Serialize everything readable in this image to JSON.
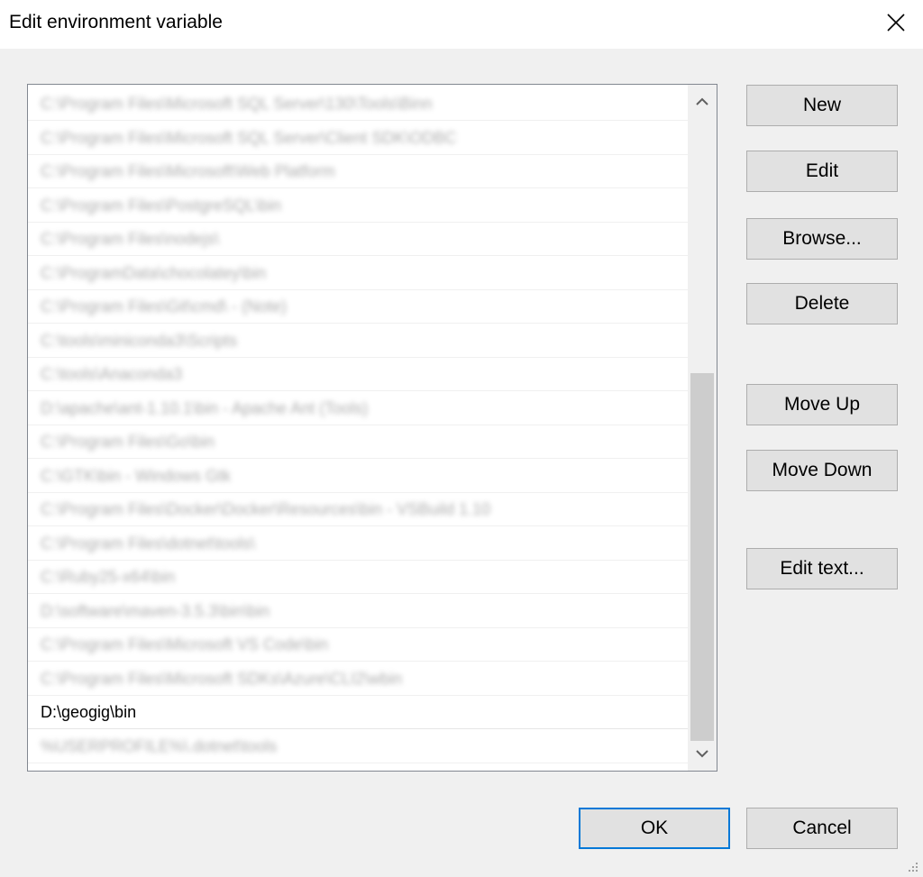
{
  "window": {
    "title": "Edit environment variable",
    "close_icon": "close-icon"
  },
  "list": {
    "items": [
      {
        "text": "C:\\Program Files\\Microsoft SQL Server\\130\\Tools\\Binn",
        "blurred": true
      },
      {
        "text": "C:\\Program Files\\Microsoft SQL Server\\Client SDK\\ODBC",
        "blurred": true
      },
      {
        "text": "C:\\Program Files\\Microsoft\\Web Platform",
        "blurred": true
      },
      {
        "text": "C:\\Program Files\\PostgreSQL\\bin",
        "blurred": true
      },
      {
        "text": "C:\\Program Files\\nodejs\\",
        "blurred": true
      },
      {
        "text": "C:\\ProgramData\\chocolatey\\bin",
        "blurred": true
      },
      {
        "text": "C:\\Program Files\\Git\\cmd\\ - (Note)",
        "blurred": true
      },
      {
        "text": "C:\\tools\\miniconda3\\Scripts",
        "blurred": true
      },
      {
        "text": "C:\\tools\\Anaconda3",
        "blurred": true
      },
      {
        "text": "D:\\apache\\ant-1.10.1\\bin - Apache Ant (Tools)",
        "blurred": true
      },
      {
        "text": "C:\\Program Files\\Go\\bin",
        "blurred": true
      },
      {
        "text": "C:\\GTK\\bin - Windows Gtk",
        "blurred": true
      },
      {
        "text": "C:\\Program Files\\Docker\\Docker\\Resources\\bin - VSBuild 1.10",
        "blurred": true
      },
      {
        "text": "C:\\Program Files\\dotnet\\tools\\",
        "blurred": true
      },
      {
        "text": "C:\\Ruby25-x64\\bin",
        "blurred": true
      },
      {
        "text": "D:\\software\\maven-3.5.3\\bin\\bin",
        "blurred": true
      },
      {
        "text": "C:\\Program Files\\Microsoft VS Code\\bin",
        "blurred": true
      },
      {
        "text": "C:\\Program Files\\Microsoft SDKs\\Azure\\CLI2\\wbin",
        "blurred": true
      },
      {
        "text": "D:\\geogig\\bin",
        "blurred": false
      },
      {
        "text": "%USERPROFILE%\\.dotnet\\tools",
        "blurred": true
      }
    ]
  },
  "buttons": {
    "new": "New",
    "edit": "Edit",
    "browse": "Browse...",
    "delete": "Delete",
    "move_up": "Move Up",
    "move_down": "Move Down",
    "edit_text": "Edit text...",
    "ok": "OK",
    "cancel": "Cancel"
  },
  "colors": {
    "accent": "#0078d7",
    "dialog_bg": "#f0f0f0",
    "button_bg": "#e1e1e1",
    "scroll_thumb": "#cdcdcd"
  }
}
